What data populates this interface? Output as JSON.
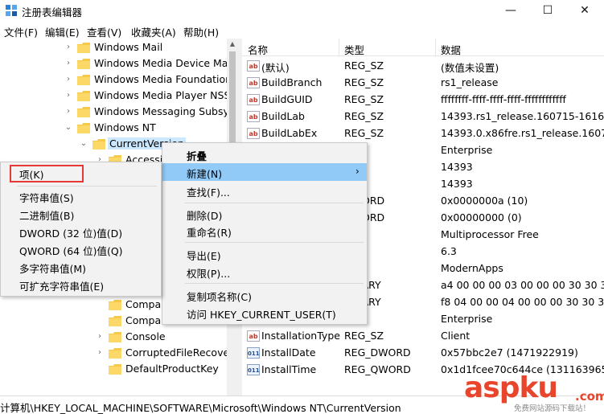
{
  "window": {
    "title": "注册表编辑器",
    "minimize": "—",
    "maximize": "☐",
    "close": "✕"
  },
  "menubar": [
    "文件(F)",
    "编辑(E)",
    "查看(V)",
    "收藏夹(A)",
    "帮助(H)"
  ],
  "tree": {
    "nodes": [
      {
        "label": "Windows Mail",
        "chevron": "›"
      },
      {
        "label": "Windows Media Device Ma",
        "chevron": "›"
      },
      {
        "label": "Windows Media Foundation",
        "chevron": "›"
      },
      {
        "label": "Windows Media Player NSS",
        "chevron": "›"
      },
      {
        "label": "Windows Messaging Subsy",
        "chevron": "›"
      },
      {
        "label": "Windows NT",
        "chevron": "⌄"
      },
      {
        "label": "CurrentVersion",
        "chevron": "⌄"
      },
      {
        "label": "Accessi",
        "chevron": "›"
      },
      {
        "label": "Compa",
        "chevron": ""
      },
      {
        "label": "Compa",
        "chevron": ""
      },
      {
        "label": "Console",
        "chevron": "›"
      },
      {
        "label": "CorruptedFileRecove",
        "chevron": "›"
      },
      {
        "label": "DefaultProductKey",
        "chevron": ""
      }
    ]
  },
  "values": {
    "headers": {
      "name": "名称",
      "type": "类型",
      "data": "数据"
    },
    "rows": [
      {
        "icon": "ab",
        "name": "(默认)",
        "type": "REG_SZ",
        "data": "(数值未设置)"
      },
      {
        "icon": "ab",
        "name": "BuildBranch",
        "type": "REG_SZ",
        "data": "rs1_release"
      },
      {
        "icon": "ab",
        "name": "BuildGUID",
        "type": "REG_SZ",
        "data": "ffffffff-ffff-ffff-ffff-ffffffffffff"
      },
      {
        "icon": "ab",
        "name": "BuildLab",
        "type": "REG_SZ",
        "data": "14393.rs1_release.160715-1616"
      },
      {
        "icon": "ab",
        "name": "BuildLabEx",
        "type": "REG_SZ",
        "data": "14393.0.x86fre.rs1_release.1607"
      },
      {
        "icon": "ab",
        "name": "",
        "type": "SZ",
        "data": "Enterprise"
      },
      {
        "icon": "ab",
        "name": "",
        "type": "SZ",
        "data": "14393"
      },
      {
        "icon": "ab",
        "name": "",
        "type": "SZ",
        "data": "14393"
      },
      {
        "icon": "num",
        "name": "",
        "type": "DWORD",
        "data": "0x0000000a (10)"
      },
      {
        "icon": "num",
        "name": "",
        "type": "DWORD",
        "data": "0x00000000 (0)"
      },
      {
        "icon": "ab",
        "name": "",
        "type": "SZ",
        "data": "Multiprocessor Free"
      },
      {
        "icon": "ab",
        "name": "",
        "type": "SZ",
        "data": "6.3"
      },
      {
        "icon": "ab",
        "name": "",
        "type": "SZ",
        "data": "ModernApps"
      },
      {
        "icon": "num",
        "name": "",
        "type": "BINARY",
        "data": "a4 00 00 00 03 00 00 00 30 30 3"
      },
      {
        "icon": "num",
        "name": "",
        "type": "BINARY",
        "data": "f8 04 00 00 04 00 00 00 30 30 3"
      },
      {
        "icon": "ab",
        "name": "",
        "type": "SZ",
        "data": "Enterprise"
      },
      {
        "icon": "ab",
        "name": "InstallationType",
        "type": "REG_SZ",
        "data": "Client"
      },
      {
        "icon": "num",
        "name": "InstallDate",
        "type": "REG_DWORD",
        "data": "0x57bbc2e7 (1471922919)"
      },
      {
        "icon": "num",
        "name": "InstallTime",
        "type": "REG_QWORD",
        "data": "0x1d1fcee70c644ce (131163965"
      }
    ]
  },
  "context_menu": {
    "items": [
      "折叠",
      "新建(N)",
      "查找(F)...",
      "删除(D)",
      "重命名(R)",
      "导出(E)",
      "权限(P)...",
      "复制项名称(C)",
      "访问 HKEY_CURRENT_USER(T)"
    ],
    "submenu_arrow": "›"
  },
  "submenu": {
    "items": [
      "项(K)",
      "字符串值(S)",
      "二进制值(B)",
      "DWORD (32 位)值(D)",
      "QWORD (64 位)值(Q)",
      "多字符串值(M)",
      "可扩充字符串值(E)"
    ]
  },
  "statusbar": {
    "path": "计算机\\HKEY_LOCAL_MACHINE\\SOFTWARE\\Microsoft\\Windows NT\\CurrentVersion"
  },
  "watermark": {
    "brand": "aspku",
    "tld": ".com",
    "slogan": "免费网站源码下载站！"
  }
}
